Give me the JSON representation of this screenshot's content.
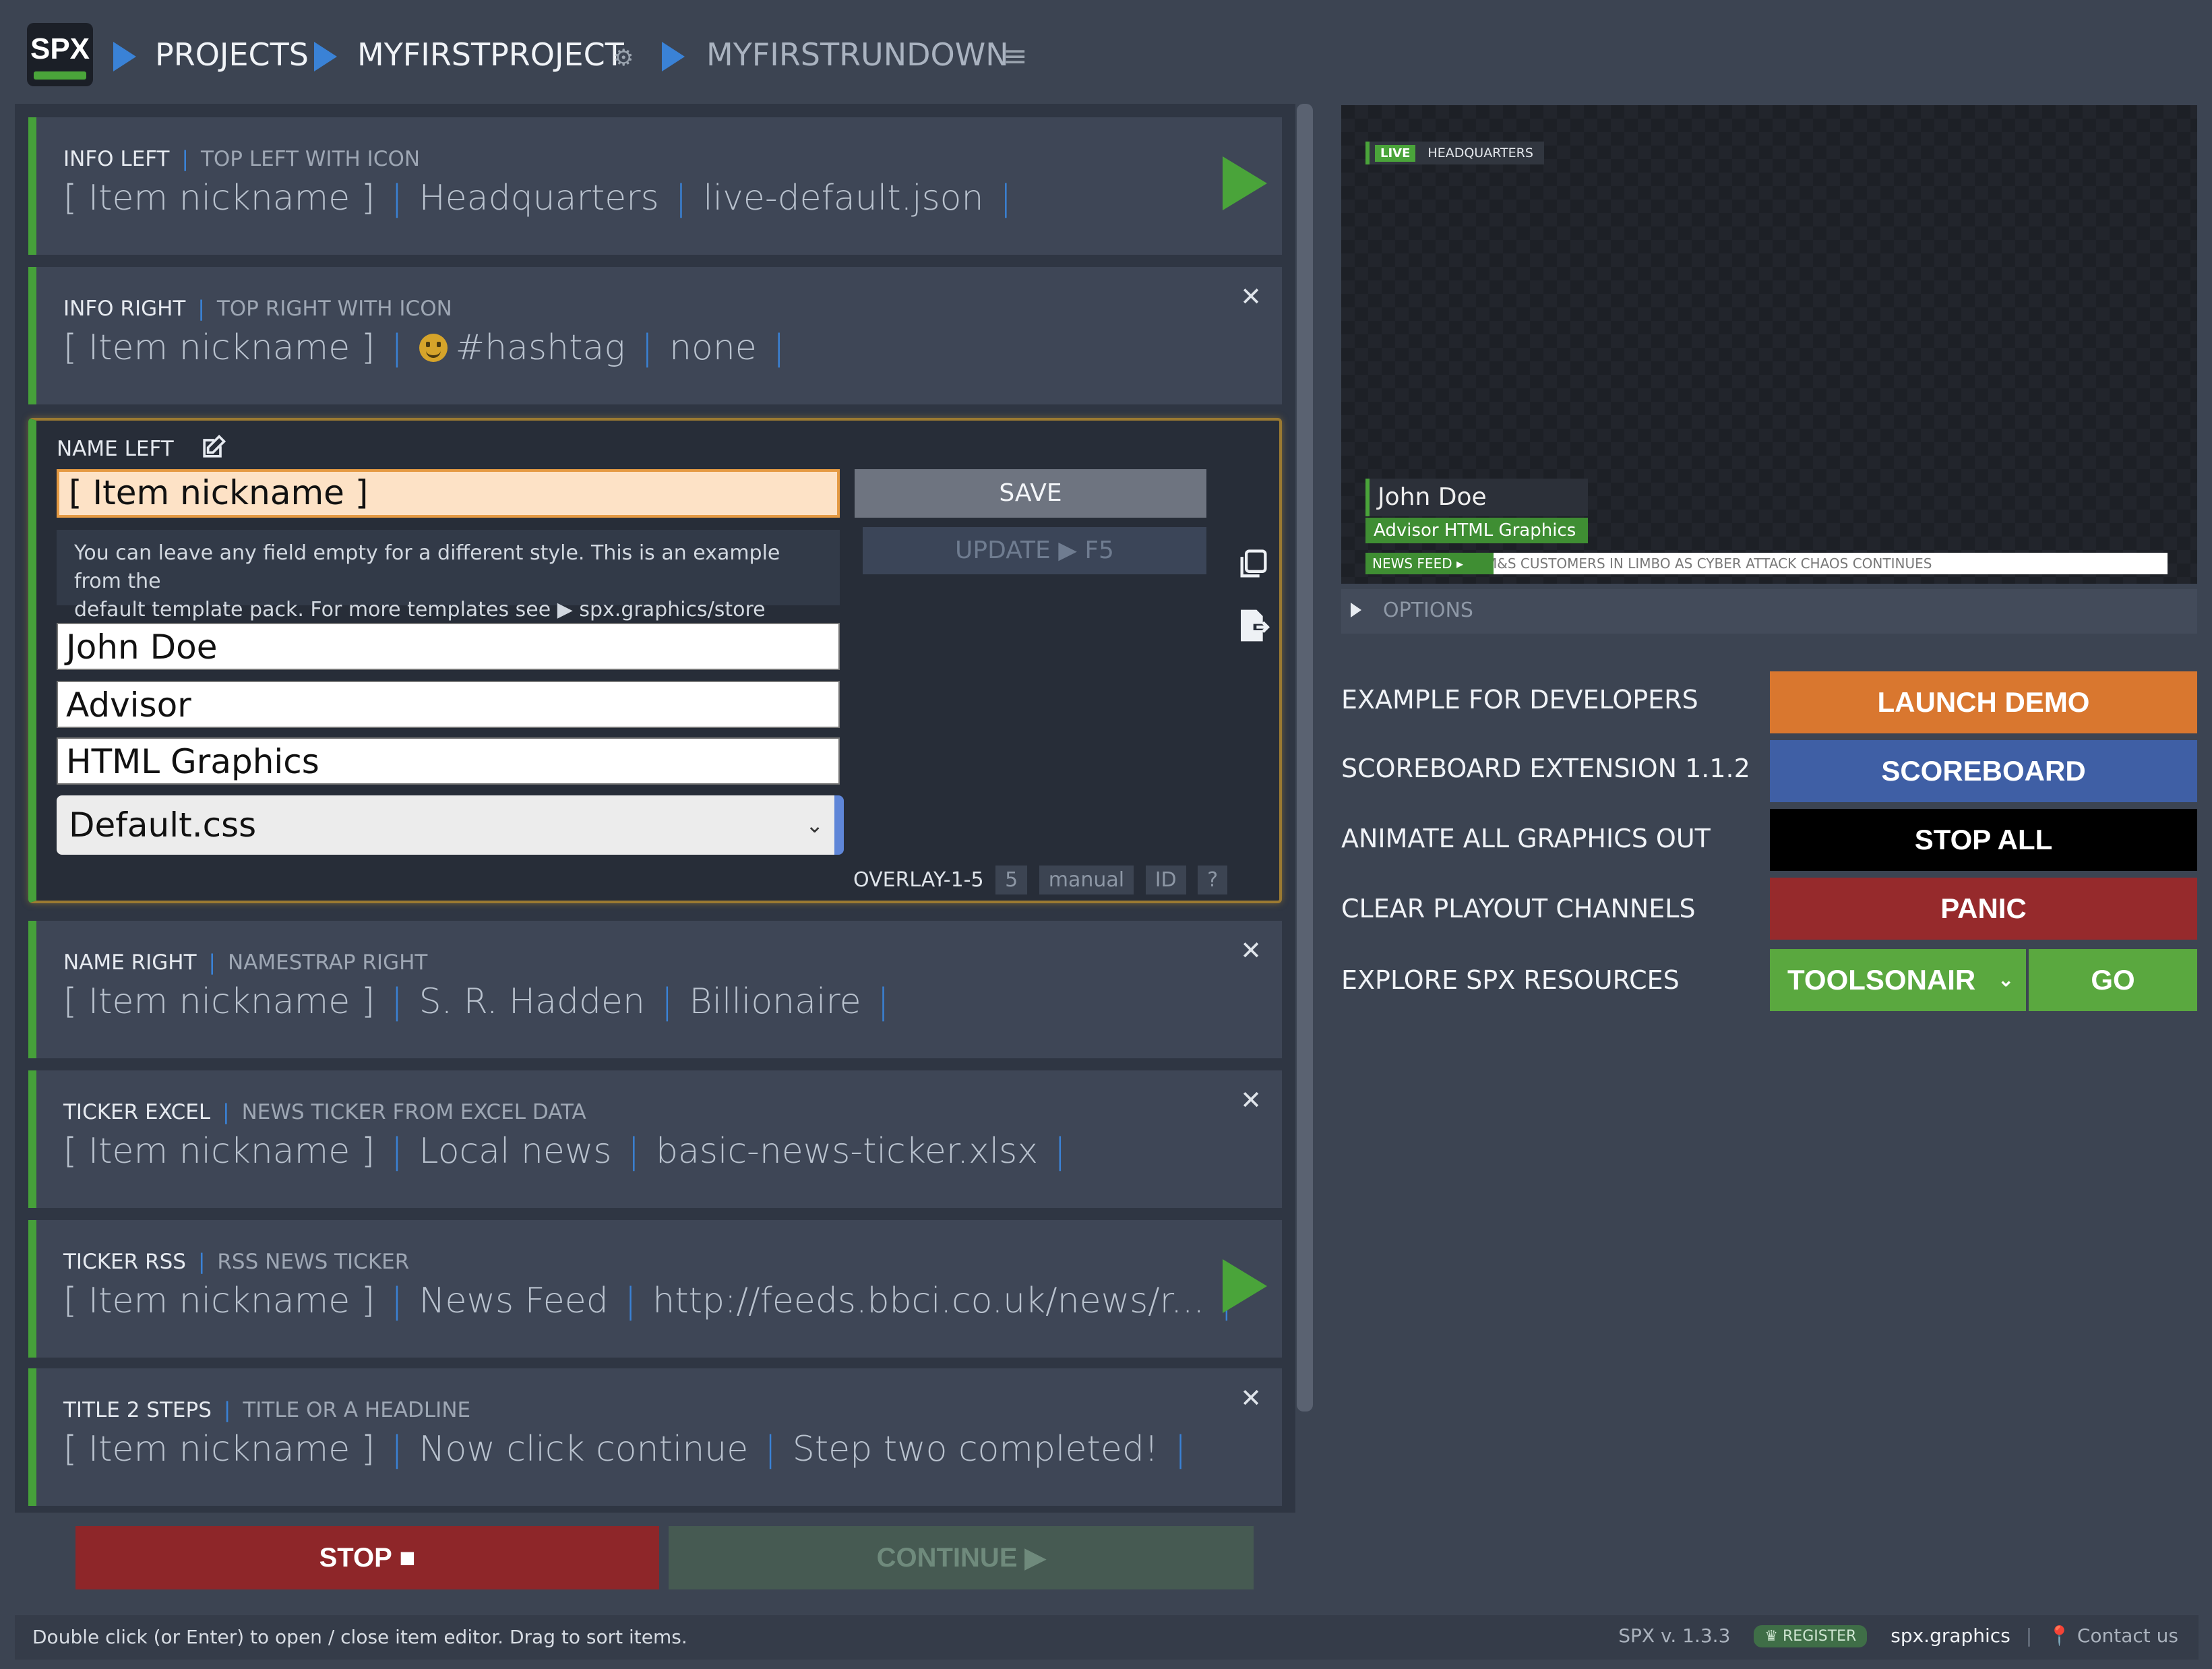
{
  "header": {
    "logo": "SPX",
    "crumbs": [
      "PROJECTS",
      "MYFIRSTPROJECT",
      "MYFIRSTRUNDOWN"
    ]
  },
  "rundown": {
    "items": [
      {
        "name": "INFO LEFT",
        "desc": "TOP LEFT WITH ICON",
        "nick": "[ Item nickname ]",
        "f1": "Headquarters",
        "f2": "live-default.json"
      },
      {
        "name": "INFO RIGHT",
        "desc": "TOP RIGHT WITH ICON",
        "nick": "[ Item nickname ]",
        "f1": "#hashtag",
        "f2": "none"
      },
      {
        "name": "NAME RIGHT",
        "desc": "NAMESTRAP RIGHT",
        "nick": "[ Item nickname ]",
        "f1": "S. R. Hadden",
        "f2": "Billionaire"
      },
      {
        "name": "TICKER EXCEL",
        "desc": "NEWS TICKER FROM EXCEL DATA",
        "nick": "[ Item nickname ]",
        "f1": "Local news",
        "f2": "basic-news-ticker.xlsx"
      },
      {
        "name": "TICKER RSS",
        "desc": "RSS NEWS TICKER",
        "nick": "[ Item nickname ]",
        "f1": "News Feed",
        "f2": "http://feeds.bbci.co.uk/news/r..."
      },
      {
        "name": "TITLE 2 STEPS",
        "desc": "TITLE OR A HEADLINE",
        "nick": "[ Item nickname ]",
        "f1": "Now click continue",
        "f2": "Step two completed!"
      }
    ],
    "editor": {
      "title": "NAME LEFT",
      "nickname": "[ Item nickname ]",
      "save_label": "SAVE",
      "update_label": "UPDATE ▶ F5",
      "info_line1": "You can leave any field empty for a different style. This is an example from the",
      "info_line2": "default template pack. For more templates see ▶ spx.graphics/store",
      "name_value": "John Doe",
      "title_value": "Advisor",
      "subtitle_value": "HTML Graphics",
      "style_value": "Default.css",
      "overlay": "OVERLAY-1-5",
      "layer": "5",
      "mode": "manual",
      "id_label": "ID",
      "help_label": "?"
    },
    "stop_label": "STOP ■",
    "continue_label": "CONTINUE ▶"
  },
  "preview": {
    "live_badge": "LIVE",
    "hq": "HEADQUARTERS",
    "name": "John Doe",
    "title": "Advisor  HTML Graphics",
    "ticker_label": "NEWS FEED",
    "ticker_text": "M&S CUSTOMERS IN LIMBO AS CYBER ATTACK CHAOS CONTINUES",
    "options_label": "OPTIONS"
  },
  "actions": [
    {
      "label": "EXAMPLE FOR DEVELOPERS",
      "button": "LAUNCH DEMO",
      "color": "#d9772f"
    },
    {
      "label": "SCOREBOARD EXTENSION 1.1.2",
      "button": "SCOREBOARD",
      "color": "#3f5fa5"
    },
    {
      "label": "ANIMATE ALL GRAPHICS OUT",
      "button": "STOP ALL",
      "color": "#000000"
    },
    {
      "label": "CLEAR PLAYOUT CHANNELS",
      "button": "PANIC",
      "color": "#962a2c"
    },
    {
      "label": "EXPLORE SPX RESOURCES",
      "button": "TOOLSONAIR",
      "go": "GO",
      "color": "#5aa83f"
    }
  ],
  "footer": {
    "hint": "Double click (or Enter) to open / close item editor. Drag to sort items.",
    "version": "SPX v. 1.3.3",
    "register": "REGISTER",
    "site": "spx.graphics",
    "contact": "Contact us"
  }
}
